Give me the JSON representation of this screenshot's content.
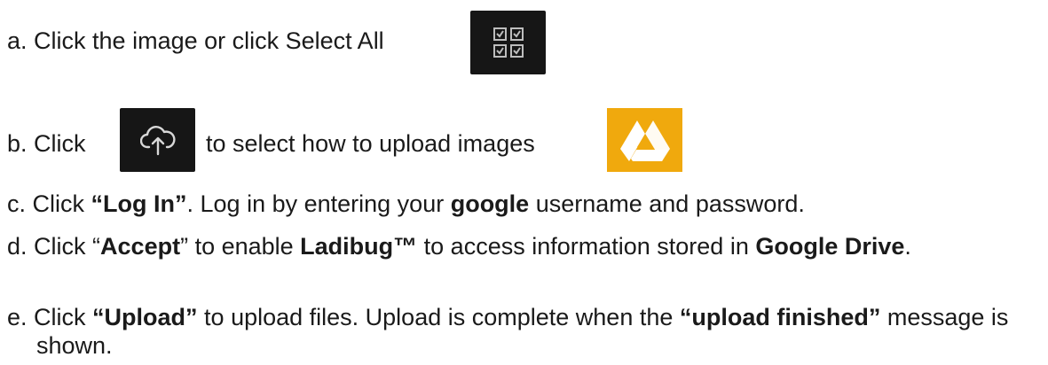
{
  "steps": {
    "a": {
      "marker": "a.",
      "text": "Click the image or click Select All",
      "icon": "select-all-icon"
    },
    "b": {
      "marker": "b.",
      "pre": "Click",
      "post": "to select how to upload images",
      "icon": "cloud-upload-icon",
      "icon2": "google-drive-icon"
    },
    "c": {
      "marker": "c.",
      "t1": "Click ",
      "b1": "“Log In”",
      "t2": ". Log in by entering your ",
      "b2": "google",
      "t3": " username and password."
    },
    "d": {
      "marker": "d.",
      "t1": "Click “",
      "b1": "Accept",
      "t2": "” to enable ",
      "b2": "Ladibug™",
      "t3": " to access information stored in ",
      "b3": "Google Drive",
      "t4": "."
    },
    "e": {
      "marker": "e.",
      "t1": "Click ",
      "b1": "“Upload”",
      "t2": " to upload files. Upload is complete when the ",
      "b2": "“upload finished”",
      "t3": " message is shown."
    }
  },
  "colors": {
    "icon_background": "#161616",
    "drive_background": "#f0a90d",
    "text": "#1a1a1a"
  }
}
